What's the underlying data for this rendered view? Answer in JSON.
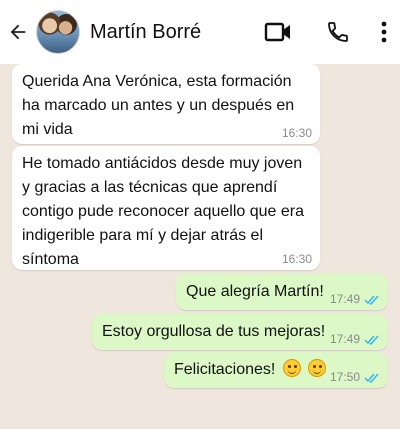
{
  "header": {
    "contact_name": "Martín Borré",
    "icons": {
      "back": "arrow-back-icon",
      "video": "video-camera-icon",
      "phone": "phone-icon",
      "menu": "more-vertical-icon"
    }
  },
  "messages": [
    {
      "direction": "incoming",
      "text": "Querida Ana Verónica, esta formación ha marcado un antes y un después en mi vida",
      "time": "16:30"
    },
    {
      "direction": "incoming",
      "text": "He tomado antiácidos desde muy joven y gracias a las técnicas que aprendí contigo pude reconocer aquello que era indigerible para mí y dejar atrás el síntoma",
      "time": "16:30"
    },
    {
      "direction": "outgoing",
      "text": "Que alegría Martín!",
      "time": "17:49",
      "status": "read"
    },
    {
      "direction": "outgoing",
      "text": "Estoy orgullosa de tus mejoras!",
      "time": "17:49",
      "status": "read"
    },
    {
      "direction": "outgoing",
      "text": "Felicitaciones!",
      "emoji": [
        "hugging-face-emoji",
        "smiling-face-emoji"
      ],
      "time": "17:50",
      "status": "read"
    }
  ],
  "colors": {
    "chat_background": "#efe7de",
    "incoming_bubble": "#ffffff",
    "outgoing_bubble": "#dcf8c6",
    "read_ticks": "#34b7f1"
  }
}
